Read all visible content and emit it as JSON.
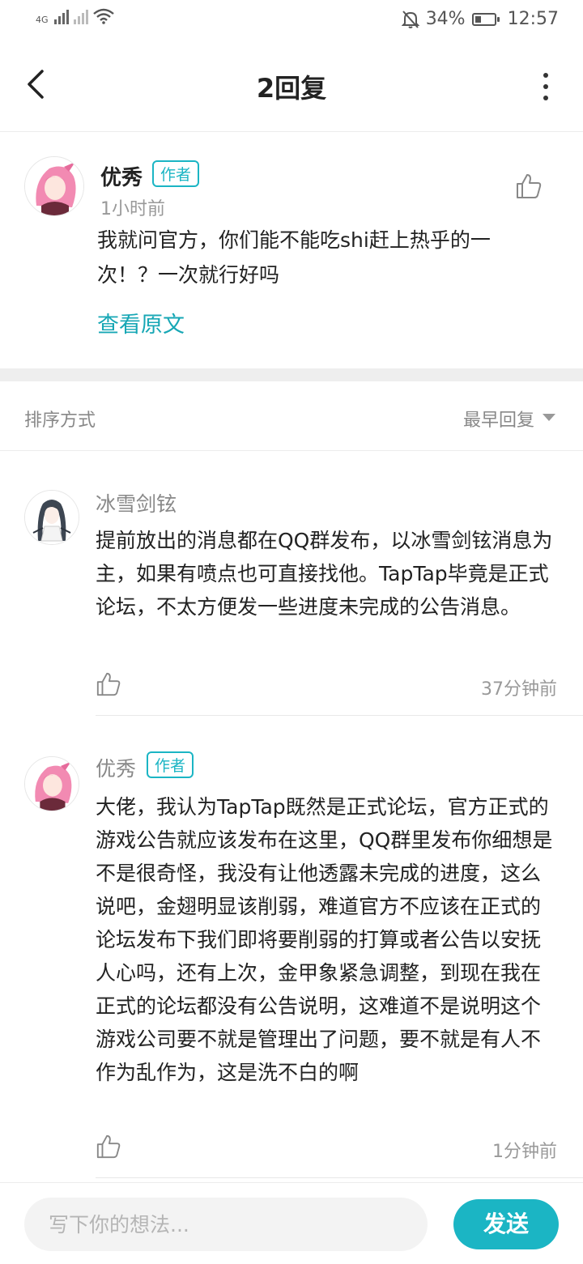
{
  "status_bar": {
    "network": "4G",
    "battery": "34%",
    "battery_level": 0.34,
    "time": "12:57",
    "icons": [
      "signal-icon",
      "signal-no-service-icon",
      "wifi-icon",
      "mute-icon",
      "battery-charging-icon"
    ]
  },
  "header": {
    "title": "2回复",
    "back_icon": "chevron-left-icon",
    "more_icon": "more-vertical-icon"
  },
  "post": {
    "username": "优秀",
    "badge": "作者",
    "time": "1小时前",
    "text": "我就问官方，你们能不能吃shi赶上热乎的一次！？一次就行好吗",
    "view_original": "查看原文"
  },
  "sort": {
    "label": "排序方式",
    "value": "最早回复"
  },
  "replies": [
    {
      "username": "冰雪剑铉",
      "text": "提前放出的消息都在QQ群发布，以冰雪剑铉消息为主，如果有喷点也可直接找他。TapTap毕竟是正式论坛，不太方便发一些进度未完成的公告消息。",
      "time": "37分钟前"
    },
    {
      "username": "优秀",
      "badge": "作者",
      "text": "大佬，我认为TapTap既然是正式论坛，官方正式的游戏公告就应该发布在这里，QQ群里发布你细想是不是很奇怪，我没有让他透露未完成的进度，这么说吧，金翅明显该削弱，难道官方不应该在正式的论坛发布下我们即将要削弱的打算或者公告以安抚人心吗，还有上次，金甲象紧急调整，到现在我在正式的论坛都没有公告说明，这难道不是说明这个游戏公司要不就是管理出了问题，要不就是有人不作为乱作为，这是洗不白的啊",
      "time": "1分钟前"
    }
  ],
  "composer": {
    "placeholder": "写下你的想法...",
    "send_label": "发送"
  },
  "colors": {
    "accent": "#1bb5c4",
    "link": "#17a7b5"
  }
}
